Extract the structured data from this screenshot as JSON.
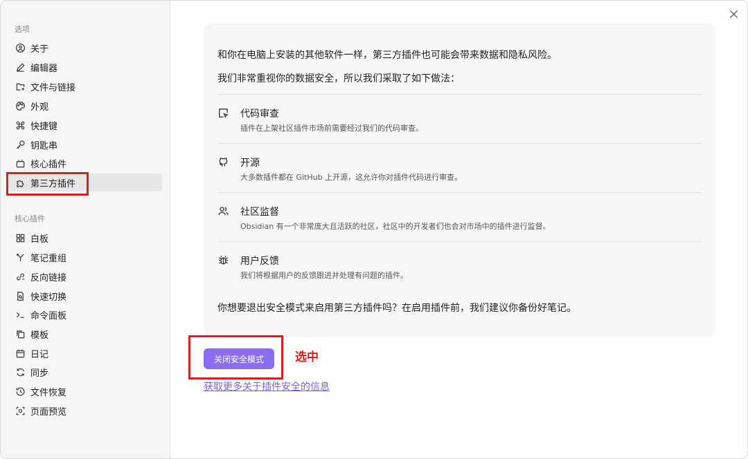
{
  "sidebar": {
    "options_title": "选项",
    "options": [
      {
        "label": "关于",
        "icon": "info-circle-icon"
      },
      {
        "label": "编辑器",
        "icon": "pencil-icon"
      },
      {
        "label": "文件与链接",
        "icon": "folder-link-icon"
      },
      {
        "label": "外观",
        "icon": "palette-icon"
      },
      {
        "label": "快捷键",
        "icon": "command-icon"
      },
      {
        "label": "钥匙串",
        "icon": "key-icon"
      },
      {
        "label": "核心插件",
        "icon": "plug-box-icon"
      },
      {
        "label": "第三方插件",
        "icon": "puzzle-icon",
        "active": true
      }
    ],
    "core_title": "核心插件",
    "core_plugins": [
      {
        "label": "白板",
        "icon": "layout-grid-icon"
      },
      {
        "label": "笔记重组",
        "icon": "merge-icon"
      },
      {
        "label": "反向链接",
        "icon": "backlink-icon"
      },
      {
        "label": "快速切换",
        "icon": "file-search-icon"
      },
      {
        "label": "命令面板",
        "icon": "terminal-icon"
      },
      {
        "label": "模板",
        "icon": "copy-icon"
      },
      {
        "label": "日记",
        "icon": "calendar-icon"
      },
      {
        "label": "同步",
        "icon": "sync-icon"
      },
      {
        "label": "文件恢复",
        "icon": "history-icon"
      },
      {
        "label": "页面预览",
        "icon": "preview-icon"
      }
    ]
  },
  "main": {
    "intro_1": "和你在电脑上安装的其他软件一样，第三方插件也可能会带来数据和隐私风险。",
    "intro_2": "我们非常重视你的数据安全，所以我们采取了如下做法：",
    "features": [
      {
        "title": "代码审查",
        "desc": "插件在上架社区插件市场前需要经过我们的代码审查。",
        "icon": "code-review-icon"
      },
      {
        "title": "开源",
        "desc": "大多数插件都在 GitHub 上开源，这允许你对插件代码进行审查。",
        "icon": "github-icon"
      },
      {
        "title": "社区监督",
        "desc": "Obsidian 有一个非常庞大且活跃的社区，社区中的开发者们也会对市场中的插件进行监督。",
        "icon": "users-icon"
      },
      {
        "title": "用户反馈",
        "desc": "我们将根据用户的反馈跟进并处理有问题的插件。",
        "icon": "bug-icon"
      }
    ],
    "question": "你想要退出安全模式来启用第三方插件吗？在启用插件前，我们建议你备份好笔记。",
    "button_label": "关闭安全模式",
    "link_label": "获取更多关于插件安全的信息"
  },
  "annotation": {
    "label": "选中",
    "color": "#d81e1e"
  },
  "colors": {
    "accent": "#8b6df0",
    "link": "#7c5ce6",
    "highlight": "#d81e1e"
  }
}
